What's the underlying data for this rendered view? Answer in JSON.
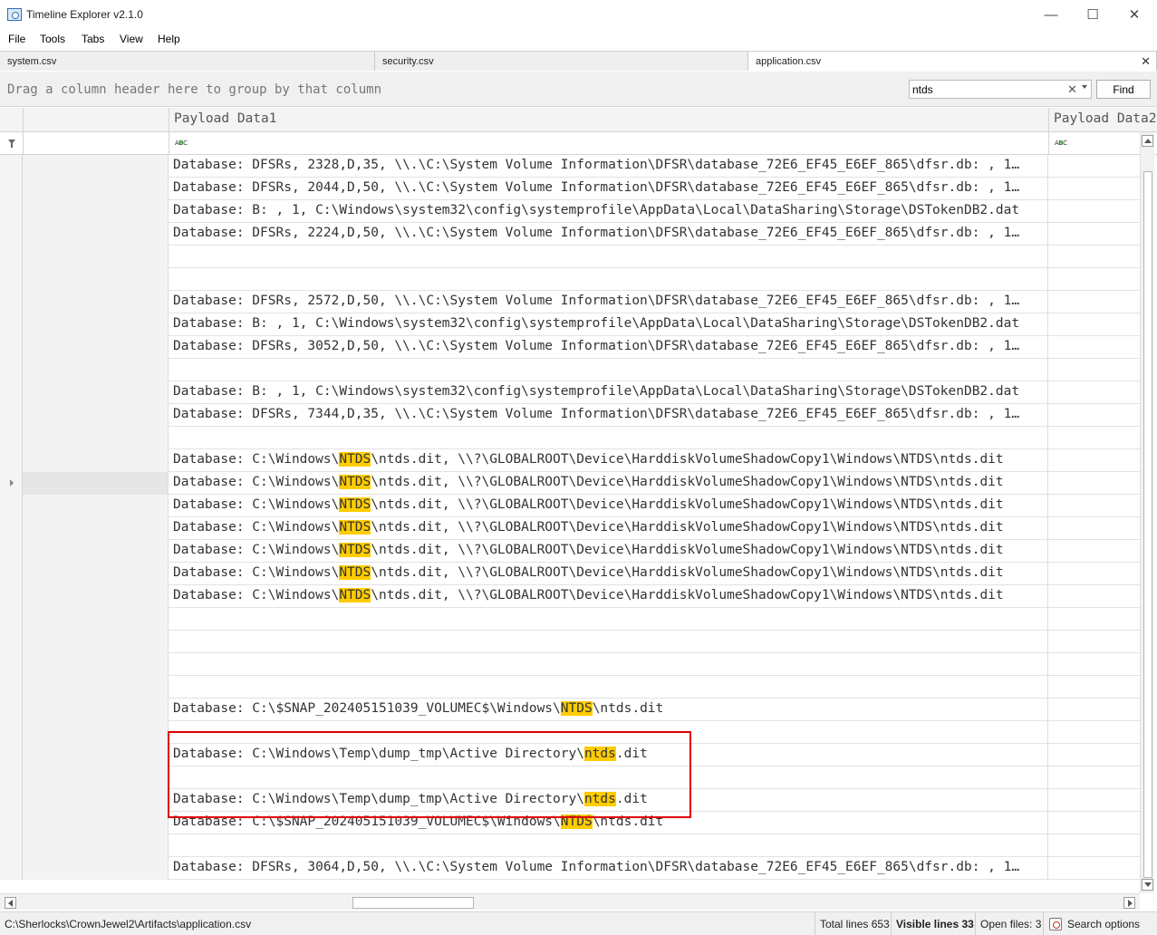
{
  "window": {
    "title": "Timeline Explorer v2.1.0",
    "minimize_glyph": "—",
    "maximize_glyph": "☐",
    "close_glyph": "✕"
  },
  "menu": [
    "File",
    "Tools",
    "Tabs",
    "View",
    "Help"
  ],
  "tabs": [
    {
      "label": "system.csv",
      "active": false
    },
    {
      "label": "security.csv",
      "active": false
    },
    {
      "label": "application.csv",
      "active": true
    }
  ],
  "tab_close_glyph": "✕",
  "group_hint": "Drag a column header here to group by that column",
  "search": {
    "value": "ntds",
    "clear_glyph": "✕",
    "find_label": "Find"
  },
  "columns": {
    "payload1": "Payload Data1",
    "payload2": "Payload Data2"
  },
  "filter_icon_label": {
    "a": "A",
    "b": "B",
    "c": "C"
  },
  "rows": [
    {
      "parts": [
        {
          "t": "Database: DFSRs, 2328,D,35, \\\\.\\C:\\System Volume Information\\DFSR\\database_72E6_EF45_E6EF_865\\dfsr.db: , 1…"
        }
      ]
    },
    {
      "parts": [
        {
          "t": "Database: DFSRs, 2044,D,50, \\\\.\\C:\\System Volume Information\\DFSR\\database_72E6_EF45_E6EF_865\\dfsr.db: , 1…"
        }
      ]
    },
    {
      "parts": [
        {
          "t": "Database: B: , 1, C:\\Windows\\system32\\config\\systemprofile\\AppData\\Local\\DataSharing\\Storage\\DSTokenDB2.dat"
        }
      ]
    },
    {
      "parts": [
        {
          "t": "Database: DFSRs, 2224,D,50, \\\\.\\C:\\System Volume Information\\DFSR\\database_72E6_EF45_E6EF_865\\dfsr.db: , 1…"
        }
      ]
    },
    {
      "parts": []
    },
    {
      "parts": []
    },
    {
      "parts": [
        {
          "t": "Database: DFSRs, 2572,D,50, \\\\.\\C:\\System Volume Information\\DFSR\\database_72E6_EF45_E6EF_865\\dfsr.db: , 1…"
        }
      ]
    },
    {
      "parts": [
        {
          "t": "Database: B: , 1, C:\\Windows\\system32\\config\\systemprofile\\AppData\\Local\\DataSharing\\Storage\\DSTokenDB2.dat"
        }
      ]
    },
    {
      "parts": [
        {
          "t": "Database: DFSRs, 3052,D,50, \\\\.\\C:\\System Volume Information\\DFSR\\database_72E6_EF45_E6EF_865\\dfsr.db: , 1…"
        }
      ]
    },
    {
      "parts": []
    },
    {
      "parts": [
        {
          "t": "Database: B: , 1, C:\\Windows\\system32\\config\\systemprofile\\AppData\\Local\\DataSharing\\Storage\\DSTokenDB2.dat"
        }
      ]
    },
    {
      "parts": [
        {
          "t": "Database: DFSRs, 7344,D,35, \\\\.\\C:\\System Volume Information\\DFSR\\database_72E6_EF45_E6EF_865\\dfsr.db: , 1…"
        }
      ]
    },
    {
      "parts": []
    },
    {
      "parts": [
        {
          "t": "Database: C:\\Windows\\"
        },
        {
          "t": "NTDS",
          "hl": true
        },
        {
          "t": "\\ntds.dit, \\\\?\\GLOBALROOT\\Device\\HarddiskVolumeShadowCopy1\\Windows\\NTDS\\ntds.dit"
        }
      ]
    },
    {
      "parts": [
        {
          "t": "Database: C:\\Windows\\"
        },
        {
          "t": "NTDS",
          "hl": true
        },
        {
          "t": "\\ntds.dit, \\\\?\\GLOBALROOT\\Device\\HarddiskVolumeShadowCopy1\\Windows\\NTDS\\ntds.dit"
        }
      ],
      "current": true
    },
    {
      "parts": [
        {
          "t": "Database: C:\\Windows\\"
        },
        {
          "t": "NTDS",
          "hl": true
        },
        {
          "t": "\\ntds.dit, \\\\?\\GLOBALROOT\\Device\\HarddiskVolumeShadowCopy1\\Windows\\NTDS\\ntds.dit"
        }
      ]
    },
    {
      "parts": [
        {
          "t": "Database: C:\\Windows\\"
        },
        {
          "t": "NTDS",
          "hl": true
        },
        {
          "t": "\\ntds.dit, \\\\?\\GLOBALROOT\\Device\\HarddiskVolumeShadowCopy1\\Windows\\NTDS\\ntds.dit"
        }
      ]
    },
    {
      "parts": [
        {
          "t": "Database: C:\\Windows\\"
        },
        {
          "t": "NTDS",
          "hl": true
        },
        {
          "t": "\\ntds.dit, \\\\?\\GLOBALROOT\\Device\\HarddiskVolumeShadowCopy1\\Windows\\NTDS\\ntds.dit"
        }
      ]
    },
    {
      "parts": [
        {
          "t": "Database: C:\\Windows\\"
        },
        {
          "t": "NTDS",
          "hl": true
        },
        {
          "t": "\\ntds.dit, \\\\?\\GLOBALROOT\\Device\\HarddiskVolumeShadowCopy1\\Windows\\NTDS\\ntds.dit"
        }
      ]
    },
    {
      "parts": [
        {
          "t": "Database: C:\\Windows\\"
        },
        {
          "t": "NTDS",
          "hl": true
        },
        {
          "t": "\\ntds.dit, \\\\?\\GLOBALROOT\\Device\\HarddiskVolumeShadowCopy1\\Windows\\NTDS\\ntds.dit"
        }
      ]
    },
    {
      "parts": []
    },
    {
      "parts": []
    },
    {
      "parts": []
    },
    {
      "parts": []
    },
    {
      "parts": [
        {
          "t": "Database: C:\\$SNAP_202405151039_VOLUMEC$\\Windows\\"
        },
        {
          "t": "NTDS",
          "hl": true
        },
        {
          "t": "\\ntds.dit"
        }
      ]
    },
    {
      "parts": []
    },
    {
      "parts": [
        {
          "t": "Database: C:\\Windows\\Temp\\dump_tmp\\Active Directory\\"
        },
        {
          "t": "ntds",
          "hl": true
        },
        {
          "t": ".dit"
        }
      ]
    },
    {
      "parts": []
    },
    {
      "parts": [
        {
          "t": "Database: C:\\Windows\\Temp\\dump_tmp\\Active Directory\\"
        },
        {
          "t": "ntds",
          "hl": true
        },
        {
          "t": ".dit"
        }
      ]
    },
    {
      "parts": [
        {
          "t": "Database: C:\\$SNAP_202405151039_VOLUMEC$\\Windows\\"
        },
        {
          "t": "NTDS",
          "hl": true
        },
        {
          "t": "\\ntds.dit"
        }
      ]
    },
    {
      "parts": []
    },
    {
      "parts": [
        {
          "t": "Database: DFSRs, 3064,D,50, \\\\.\\C:\\System Volume Information\\DFSR\\database_72E6_EF45_E6EF_865\\dfsr.db: , 1…"
        }
      ]
    }
  ],
  "status": {
    "path": "C:\\Sherlocks\\CrownJewel2\\Artifacts\\application.csv",
    "total_lines": "Total lines 653",
    "visible_lines": "Visible lines 33",
    "open_files": "Open files: 3",
    "search_options": "Search options"
  },
  "colors": {
    "highlight": "#ffcc00",
    "annotation_box": "#e00000"
  }
}
